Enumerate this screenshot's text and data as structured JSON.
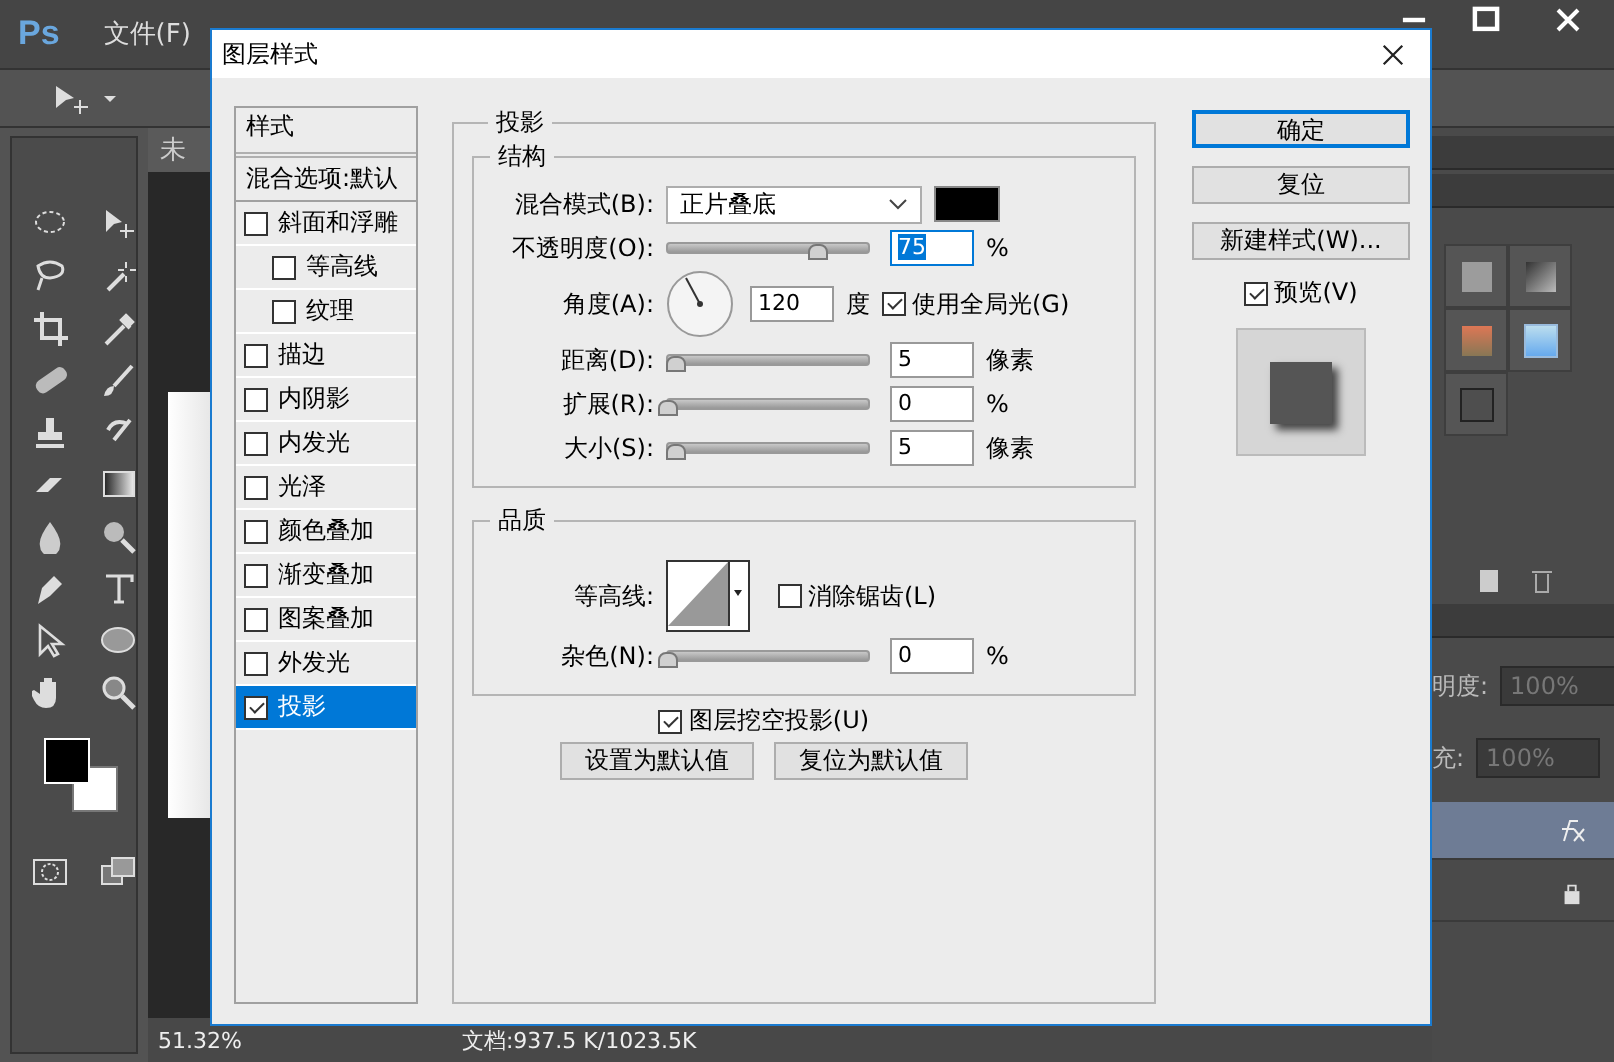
{
  "app": {
    "logo": "Ps",
    "menu": [
      "文件(F)"
    ],
    "document_tab": "未",
    "layers_panel": {
      "opacity_label": "明度:",
      "opacity": "100%",
      "fill_label": "充:",
      "fill": "100%"
    },
    "status_bar": {
      "zoom": "51.32%",
      "document": "文档:937.5 K/1023.5K"
    }
  },
  "dialog": {
    "title": "图层样式",
    "styles_header": "样式",
    "blending_options": "混合选项:默认",
    "styles": [
      {
        "label": "斜面和浮雕",
        "checked": false,
        "selected": false,
        "children": [
          {
            "label": "等高线",
            "checked": false,
            "selected": false
          },
          {
            "label": "纹理",
            "checked": false,
            "selected": false
          }
        ]
      },
      {
        "label": "描边",
        "checked": false,
        "selected": false
      },
      {
        "label": "内阴影",
        "checked": false,
        "selected": false
      },
      {
        "label": "内发光",
        "checked": false,
        "selected": false
      },
      {
        "label": "光泽",
        "checked": false,
        "selected": false
      },
      {
        "label": "颜色叠加",
        "checked": false,
        "selected": false
      },
      {
        "label": "渐变叠加",
        "checked": false,
        "selected": false
      },
      {
        "label": "图案叠加",
        "checked": false,
        "selected": false
      },
      {
        "label": "外发光",
        "checked": false,
        "selected": false
      },
      {
        "label": "投影",
        "checked": true,
        "selected": true
      }
    ],
    "section_title": "投影",
    "structure": {
      "title": "结构",
      "blend_mode_label": "混合模式(B):",
      "blend_mode": "正片叠底",
      "color": "#000000",
      "opacity": {
        "label": "不透明度(O):",
        "level": 0.75,
        "value": "75",
        "unit": "%"
      },
      "angle": {
        "label": "角度(A):",
        "value": "120",
        "unit": "度"
      },
      "global_light": {
        "label": "使用全局光(G)",
        "checked": true
      },
      "sliders": [
        {
          "label": "距离(D):",
          "level": 0.04,
          "value": "5",
          "unit": "像素"
        },
        {
          "label": "扩展(R):",
          "level": 0,
          "value": "0",
          "unit": "%"
        },
        {
          "label": "大小(S):",
          "level": 0.04,
          "value": "5",
          "unit": "像素"
        }
      ]
    },
    "quality": {
      "title": "品质",
      "contour_label": "等高线:",
      "anti_alias": {
        "label": "消除锯齿(L)",
        "checked": false
      },
      "noise": {
        "label": "杂色(N):",
        "level": 0,
        "value": "0",
        "unit": "%"
      }
    },
    "knockout": {
      "label": "图层挖空投影(U)",
      "checked": true
    },
    "default_buttons": [
      "设置为默认值",
      "复位为默认值"
    ],
    "buttons": [
      {
        "label": "确定",
        "focused": true
      },
      {
        "label": "复位",
        "focused": false
      },
      {
        "label": "新建样式(W)...",
        "focused": false
      }
    ],
    "preview": {
      "label": "预览(V)",
      "checked": true
    }
  }
}
